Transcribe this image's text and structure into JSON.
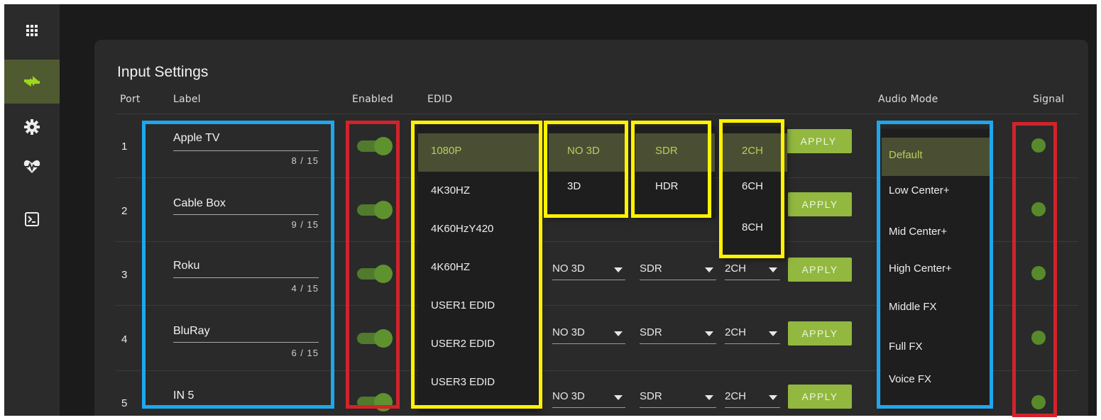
{
  "sidebar": {
    "items": [
      {
        "icon": "grid-icon",
        "active": false
      },
      {
        "icon": "swap-arrows-icon",
        "active": true
      },
      {
        "icon": "gear-icon",
        "active": false
      },
      {
        "icon": "heartbeat-icon",
        "active": false
      },
      {
        "icon": "terminal-icon",
        "active": false
      }
    ]
  },
  "panel": {
    "title": "Input Settings",
    "headers": {
      "port": "Port",
      "label": "Label",
      "enabled": "Enabled",
      "edid": "EDID",
      "audio_mode": "Audio Mode",
      "signal": "Signal"
    }
  },
  "rows": [
    {
      "port": "1",
      "label": "Apple TV",
      "counter": "8 / 15",
      "enabled": true,
      "apply": "APPLY",
      "signal": true
    },
    {
      "port": "2",
      "label": "Cable Box",
      "counter": "9 / 15",
      "enabled": true,
      "apply": "APPLY",
      "signal": true
    },
    {
      "port": "3",
      "label": "Roku",
      "counter": "4 / 15",
      "enabled": true,
      "three_d": "NO 3D",
      "hdr": "SDR",
      "channels": "2CH",
      "apply": "APPLY",
      "signal": true
    },
    {
      "port": "4",
      "label": "BluRay",
      "counter": "6 / 15",
      "enabled": true,
      "three_d": "NO 3D",
      "hdr": "SDR",
      "channels": "2CH",
      "apply": "APPLY",
      "signal": true
    },
    {
      "port": "5",
      "label": "IN 5",
      "enabled": true,
      "three_d": "NO 3D",
      "hdr": "SDR",
      "channels": "2CH",
      "apply": "APPLY",
      "signal": true
    }
  ],
  "menus": {
    "edid": {
      "selected": "1080P",
      "options": [
        "1080P",
        "4K30HZ",
        "4K60HzY420",
        "4K60HZ",
        "USER1 EDID",
        "USER2 EDID",
        "USER3 EDID"
      ]
    },
    "three_d": {
      "selected": "NO 3D",
      "options": [
        "NO 3D",
        "3D"
      ]
    },
    "hdr": {
      "selected": "SDR",
      "options": [
        "SDR",
        "HDR"
      ]
    },
    "channels": {
      "selected": "2CH",
      "options": [
        "2CH",
        "6CH",
        "8CH"
      ]
    },
    "audio_mode": {
      "selected": "Default",
      "options": [
        "Default",
        "Low Center+",
        "Mid Center+",
        "High Center+",
        "Middle FX",
        "Full FX",
        "Voice FX"
      ]
    }
  },
  "colors": {
    "accent": "#92b83f",
    "signal_on": "#588a2c",
    "annotation_blue": "#1ea7ee",
    "annotation_red": "#d2232a",
    "annotation_yellow": "#fff200"
  }
}
